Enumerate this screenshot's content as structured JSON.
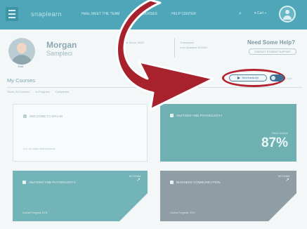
{
  "navbar": {
    "brand": "snaplearn",
    "links": [
      "Hello, MEET THE TEAM",
      "MY COURSES",
      "HELP CENTER"
    ],
    "search_icon": "search-icon",
    "cart": "▾ Cart ◐"
  },
  "profile": {
    "first_name": "Morgan",
    "last_name": "Sampleci",
    "edit_label": "Edit",
    "info_line": "Member Since: 2020",
    "info2_line1": "Transcripts",
    "info2_line2": "Last Updated 10/2021"
  },
  "help": {
    "title": "Need Some Help?",
    "button": "CONTACT STUDENT SUPPORT"
  },
  "courses": {
    "heading": "My Courses",
    "filters": [
      "Show: All Courses",
      "In Progress",
      "Completed"
    ],
    "send_button": "Send transcript",
    "sort_hint": "Sort"
  },
  "cards": {
    "welcome": {
      "title": "WELCOME TO MYLAB",
      "sub": "2 in all major themes/new"
    },
    "anatomy1": {
      "title": "ANATOMY AND PHYSIOLOGY I",
      "grade_label": "FINAL GRADE",
      "grade": "87%"
    },
    "anatomy2": {
      "title": "ANATOMY AND PHYSIOLOGY II",
      "progress": "Course Progress: 61%",
      "corner": "MY EXAM"
    },
    "business": {
      "title": "BUSINESS COMMUNICATION",
      "progress": "Course Progress: 33%",
      "corner": "MY EXAM"
    }
  },
  "colors": {
    "navbar": "#4ea6b8",
    "highlight": "#b3222f",
    "card_teal": "#6fb0b2",
    "card_grey": "#8f9ea4"
  }
}
